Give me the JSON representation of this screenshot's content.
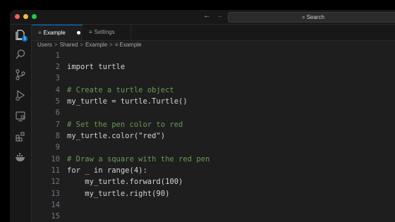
{
  "titlebar": {
    "back_arrow": "←",
    "forward_arrow": "→",
    "search_placeholder": "Search"
  },
  "activity_bar": {
    "items": [
      {
        "icon": "files-icon",
        "badge": "1"
      },
      {
        "icon": "search-icon"
      },
      {
        "icon": "source-control-icon"
      },
      {
        "icon": "run-debug-icon"
      },
      {
        "icon": "remote-explorer-icon"
      },
      {
        "icon": "extensions-icon"
      },
      {
        "icon": "docker-icon"
      }
    ]
  },
  "tabs": [
    {
      "label": "Example",
      "active": true,
      "modified": true,
      "icon": "text-file-icon"
    },
    {
      "label": "Settings",
      "active": false,
      "icon": "text-file-icon"
    }
  ],
  "breadcrumb": [
    "Users",
    "Shared",
    "Example",
    "Example"
  ],
  "editor": {
    "lines": [
      {
        "n": "1",
        "text": "",
        "kind": "code"
      },
      {
        "n": "2",
        "text": "import turtle",
        "kind": "code"
      },
      {
        "n": "3",
        "text": "",
        "kind": "code"
      },
      {
        "n": "4",
        "text": "# Create a turtle object",
        "kind": "comment"
      },
      {
        "n": "5",
        "text": "my_turtle = turtle.Turtle()",
        "kind": "code"
      },
      {
        "n": "6",
        "text": "",
        "kind": "code"
      },
      {
        "n": "7",
        "text": "# Set the pen color to red",
        "kind": "comment"
      },
      {
        "n": "8",
        "text": "my_turtle.color(\"red\")",
        "kind": "code"
      },
      {
        "n": "9",
        "text": "",
        "kind": "code"
      },
      {
        "n": "10",
        "text": "# Draw a square with the red pen",
        "kind": "comment"
      },
      {
        "n": "11",
        "text": "for _ in range(4):",
        "kind": "code"
      },
      {
        "n": "12",
        "text": "    my_turtle.forward(100)",
        "kind": "code"
      },
      {
        "n": "13",
        "text": "    my_turtle.right(90)",
        "kind": "code"
      },
      {
        "n": "14",
        "text": "",
        "kind": "code"
      },
      {
        "n": "15",
        "text": "",
        "kind": "code"
      }
    ]
  },
  "colors": {
    "accent": "#0078d4",
    "comment": "#6a9955",
    "code_text": "#d4d4d4"
  }
}
